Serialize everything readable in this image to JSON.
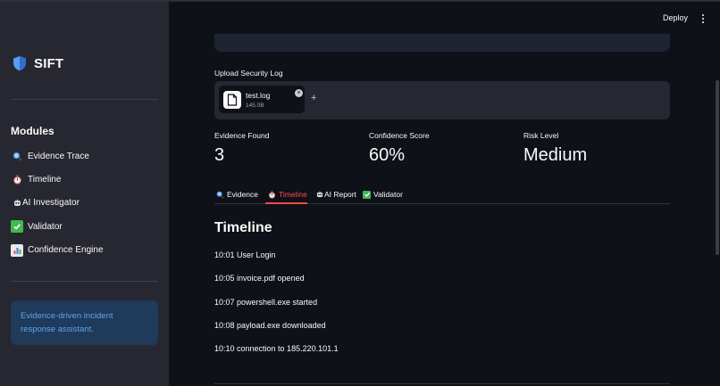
{
  "sidebar": {
    "app_title": "SIFT",
    "modules_heading": "Modules",
    "items": [
      {
        "label": "Evidence Trace",
        "icon": "magnifier-icon"
      },
      {
        "label": "Timeline",
        "icon": "stopwatch-icon"
      },
      {
        "label": "AI Investigator",
        "icon": "bot-icon"
      },
      {
        "label": "Validator",
        "icon": "check-icon"
      },
      {
        "label": "Confidence Engine",
        "icon": "bar-chart-icon"
      }
    ],
    "info_text": "Evidence-driven incident response assistant."
  },
  "toolbar": {
    "deploy_label": "Deploy"
  },
  "upload": {
    "label": "Upload Security Log",
    "file_name": "test.log",
    "file_size": "145.0B",
    "add_symbol": "+"
  },
  "metrics": [
    {
      "label": "Evidence Found",
      "value": "3"
    },
    {
      "label": "Confidence Score",
      "value": "60%"
    },
    {
      "label": "Risk Level",
      "value": "Medium"
    }
  ],
  "tabs": [
    {
      "label": "Evidence",
      "icon": "magnifier-icon"
    },
    {
      "label": "Timeline",
      "icon": "stopwatch-icon",
      "active": true
    },
    {
      "label": "AI Report",
      "icon": "bot-icon"
    },
    {
      "label": "Validator",
      "icon": "check-icon"
    }
  ],
  "timeline": {
    "title": "Timeline",
    "events": [
      "10:01 User Login",
      "10:05 invoice.pdf opened",
      "10:07 powershell.exe started",
      "10:08 payload.exe downloaded",
      "10:10 connection to 185.220.101.1"
    ]
  },
  "colors": {
    "accent": "#ff4b4b",
    "sidebar_bg": "#262730",
    "main_bg": "#0e1117",
    "info_bg": "#1f3a5a",
    "info_text": "#5ea6f0",
    "shield": "#5b9bf0"
  }
}
